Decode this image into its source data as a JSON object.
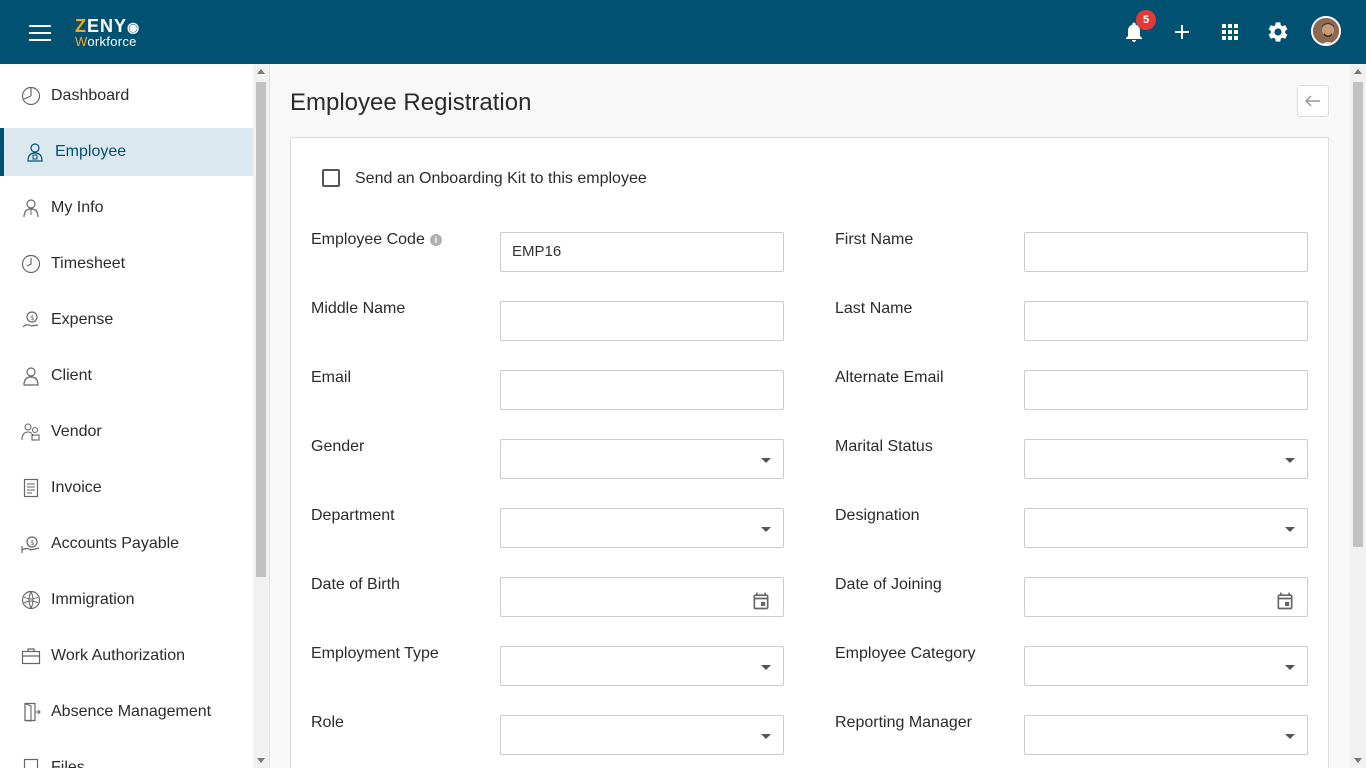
{
  "app": {
    "logo_line1": "ZENY",
    "logo_line2": "Workforce",
    "notification_count": "5"
  },
  "topbar_icons": [
    "menu-icon",
    "bell-icon",
    "plus-icon",
    "apps-grid-icon",
    "gear-icon",
    "avatar"
  ],
  "sidebar": {
    "items": [
      {
        "label": "Dashboard",
        "icon": "dashboard-icon"
      },
      {
        "label": "Employee",
        "icon": "employee-icon",
        "active": true
      },
      {
        "label": "My Info",
        "icon": "my-info-icon"
      },
      {
        "label": "Timesheet",
        "icon": "timesheet-icon"
      },
      {
        "label": "Expense",
        "icon": "expense-icon"
      },
      {
        "label": "Client",
        "icon": "client-icon"
      },
      {
        "label": "Vendor",
        "icon": "vendor-icon"
      },
      {
        "label": "Invoice",
        "icon": "invoice-icon"
      },
      {
        "label": "Accounts Payable",
        "icon": "accounts-payable-icon"
      },
      {
        "label": "Immigration",
        "icon": "immigration-icon"
      },
      {
        "label": "Work Authorization",
        "icon": "work-authorization-icon"
      },
      {
        "label": "Absence Management",
        "icon": "absence-icon"
      },
      {
        "label": "Files",
        "icon": "files-icon"
      }
    ]
  },
  "main": {
    "title": "Employee Registration",
    "onboarding_label": "Send an Onboarding Kit to this employee",
    "fields": {
      "employee_code": {
        "label": "Employee Code",
        "value": "EMP16"
      },
      "first_name": {
        "label": "First Name",
        "value": ""
      },
      "middle_name": {
        "label": "Middle Name",
        "value": ""
      },
      "last_name": {
        "label": "Last Name",
        "value": ""
      },
      "email": {
        "label": "Email",
        "value": ""
      },
      "alternate_email": {
        "label": "Alternate Email",
        "value": ""
      },
      "gender": {
        "label": "Gender",
        "value": ""
      },
      "marital_status": {
        "label": "Marital Status",
        "value": ""
      },
      "department": {
        "label": "Department",
        "value": ""
      },
      "designation": {
        "label": "Designation",
        "value": ""
      },
      "date_of_birth": {
        "label": "Date of Birth",
        "value": ""
      },
      "date_of_joining": {
        "label": "Date of Joining",
        "value": ""
      },
      "employment_type": {
        "label": "Employment Type",
        "value": ""
      },
      "employee_category": {
        "label": "Employee Category",
        "value": ""
      },
      "role": {
        "label": "Role",
        "value": ""
      },
      "reporting_manager": {
        "label": "Reporting Manager",
        "value": ""
      }
    }
  },
  "colors": {
    "header": "#015272",
    "accent": "#f5a623",
    "badge": "#e53935",
    "active_nav_bg": "#dce8ef"
  }
}
